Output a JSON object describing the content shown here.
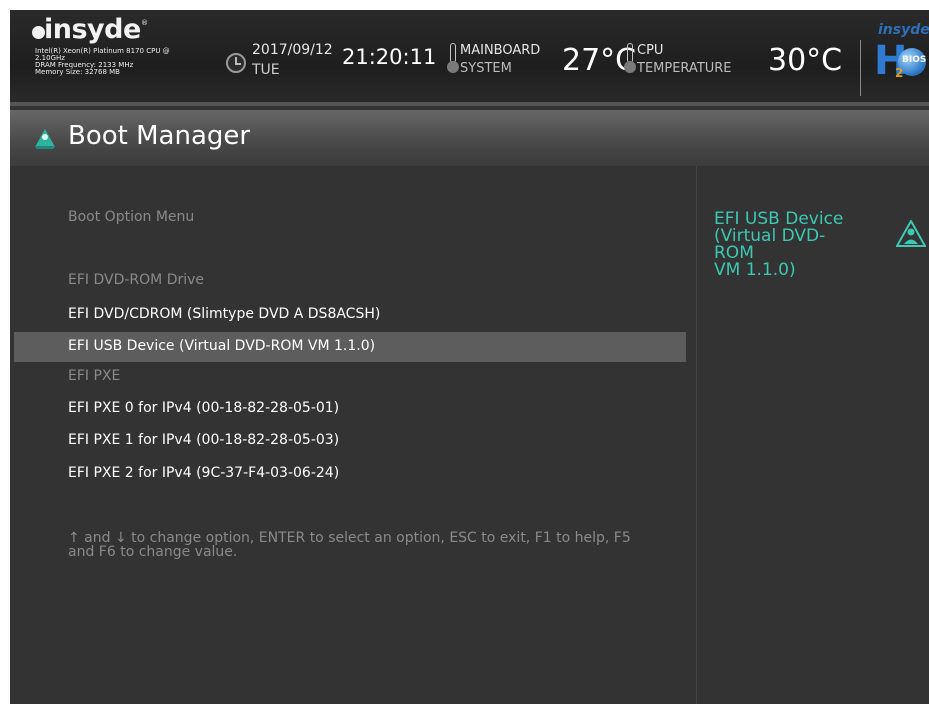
{
  "header": {
    "brand": "insyde",
    "sysinfo": [
      "Intel(R) Xeon(R) Platinum 8170 CPU @",
      "2.10GHz",
      "DRAM Frequency: 2133 MHz",
      "Memory Size: 32768 MB"
    ],
    "date": "2017/09/12",
    "day": "TUE",
    "time": "21:20:11",
    "mainboard_label": "MAINBOARD",
    "mainboard_sub": "SYSTEM",
    "mainboard_temp": "27°C",
    "cpu_label": "CPU",
    "cpu_sub": "TEMPERATURE",
    "cpu_temp": "30°C",
    "h2_brand": "insyde",
    "h2_letter": "H",
    "h2_num": "2",
    "h2_bios": "BIOS"
  },
  "page": {
    "title": "Boot Manager"
  },
  "menu": {
    "heading": "Boot Option Menu",
    "groups": [
      {
        "label": "EFI DVD-ROM Drive",
        "options": [
          "EFI DVD/CDROM (Slimtype DVD A  DS8ACSH)",
          "EFI USB Device (Virtual DVD-ROM VM 1.1.0)"
        ]
      },
      {
        "label": "EFI PXE",
        "options": [
          "EFI PXE 0 for IPv4 (00-18-82-28-05-01)",
          "EFI PXE 1 for IPv4 (00-18-82-28-05-03)",
          "EFI PXE 2 for IPv4 (9C-37-F4-03-06-24)"
        ]
      }
    ],
    "selected": "EFI USB Device (Virtual DVD-ROM VM 1.1.0)",
    "help_line1": "↑ and ↓ to change option, ENTER to select an option, ESC to exit, F1 to help, F5",
    "help_line2": "and F6 to change value."
  },
  "side": {
    "line1": "EFI USB Device",
    "line2": "(Virtual DVD-ROM",
    "line3": "VM 1.1.0)"
  },
  "colors": {
    "accent": "#3cc8b2",
    "background": "#333333",
    "selection": "#5d5d5d",
    "dim_text": "#8a8a8a"
  },
  "icons": {
    "clock": "clock-icon",
    "thermometer": "thermometer-icon",
    "title": "boot-manager-icon",
    "help": "help-person-icon"
  }
}
